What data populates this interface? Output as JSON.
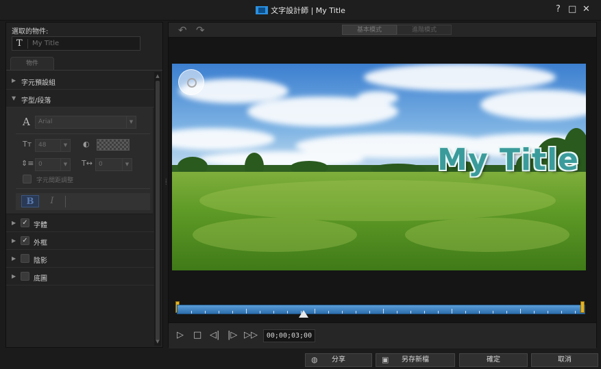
{
  "window": {
    "title": "文字設計師 | My Title",
    "help_label": "?",
    "maximize_label": "□",
    "close_label": "✕"
  },
  "left_panel": {
    "selected_object_label": "選取的物件:",
    "selected_object_value": "My Title",
    "object_tab_label": "物件",
    "sections": [
      {
        "label": "字元預設組",
        "expanded": false,
        "has_checkbox": false
      },
      {
        "label": "字型/段落",
        "expanded": true,
        "has_checkbox": false
      },
      {
        "label": "字體",
        "expanded": false,
        "has_checkbox": true,
        "checked": true
      },
      {
        "label": "外框",
        "expanded": false,
        "has_checkbox": true,
        "checked": true
      },
      {
        "label": "陰影",
        "expanded": false,
        "has_checkbox": true,
        "checked": false
      },
      {
        "label": "底圖",
        "expanded": false,
        "has_checkbox": true,
        "checked": false
      }
    ],
    "font": {
      "family": "Arial",
      "size": "48",
      "line_spacing": "0",
      "char_spacing": "0",
      "kerning_label": "字元間距調整",
      "bold_label": "B",
      "italic_label": "I"
    }
  },
  "toolbar": {
    "mode_basic": "基本模式",
    "mode_advanced": "進階模式"
  },
  "preview": {
    "title_text": "My Title"
  },
  "player": {
    "timecode": "00;00;03;00",
    "progress_fraction": 0.31
  },
  "bottom_buttons": {
    "share": "分享",
    "save_as": "另存新檔",
    "ok": "確定",
    "cancel": "取消"
  },
  "icons": [
    "app-logo-icon",
    "text-t-icon",
    "font-a-icon",
    "font-size-icon",
    "color-icon",
    "line-spacing-icon",
    "char-spacing-icon",
    "undo-icon",
    "redo-icon",
    "play-icon",
    "stop-icon",
    "prev-frame-icon",
    "next-frame-icon",
    "fast-forward-icon",
    "share-icon",
    "save-icon",
    "view-nav-icon"
  ],
  "colors": {
    "accent": "#2a8fe0",
    "timeline": "#3f86c6",
    "title_fill": "#3b9b9b",
    "title_outline": "#e8f6f6",
    "marker": "#e3b323"
  }
}
